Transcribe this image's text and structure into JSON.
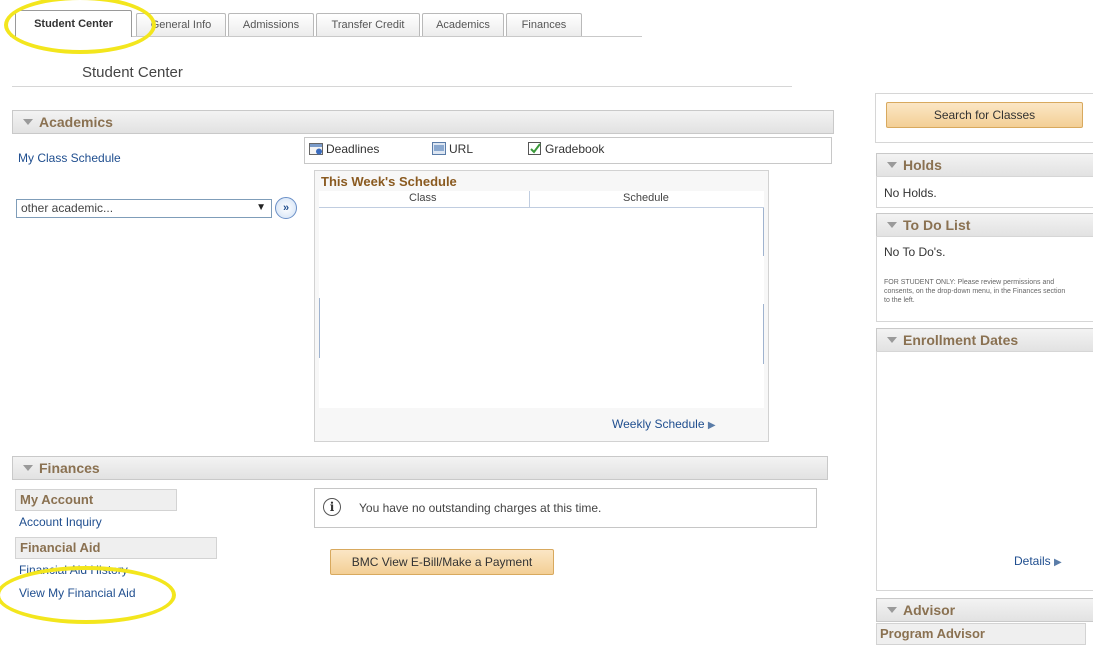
{
  "tabs": [
    "Student Center",
    "General Info",
    "Admissions",
    "Transfer Credit",
    "Academics",
    "Finances"
  ],
  "page_title": "Student Center",
  "academics": {
    "header": "Academics",
    "my_class_schedule": "My Class Schedule",
    "select_value": "other academic...",
    "shortcuts": {
      "deadlines": "Deadlines",
      "url": "URL",
      "gradebook": "Gradebook"
    },
    "this_week_title": "This Week's Schedule",
    "col_class": "Class",
    "col_schedule": "Schedule",
    "weekly_schedule": "Weekly Schedule"
  },
  "finances": {
    "header": "Finances",
    "my_account": "My Account",
    "account_inquiry": "Account Inquiry",
    "financial_aid": "Financial Aid",
    "financial_aid_history": "Financial Aid History",
    "view_my_financial_aid": "View My Financial Aid",
    "no_charges_msg": "You have no outstanding charges at this time.",
    "bmc_button": "BMC View E-Bill/Make a Payment"
  },
  "right": {
    "search_classes": "Search for Classes",
    "holds_header": "Holds",
    "no_holds": "No Holds.",
    "todo_header": "To Do List",
    "no_todos": "No To Do's.",
    "todo_note": "FOR STUDENT ONLY: Please review permissions and consents, on the drop-down menu, in the Finances section to the left.",
    "enrollment_header": "Enrollment Dates",
    "details": "Details",
    "advisor_header": "Advisor",
    "program_advisor": "Program Advisor"
  },
  "colors": {
    "highlight": "#f3e61d",
    "section_text": "#8a7151",
    "link": "#1f4e8f",
    "button_orange": "#f3cf95"
  }
}
